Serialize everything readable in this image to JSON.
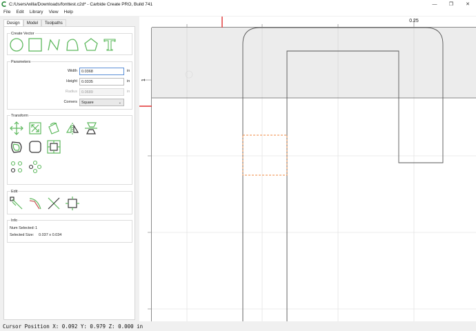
{
  "window": {
    "title": "C:/Users/willa/Downloads/fonttest.c2d* - Carbide Create PRO, Build 741",
    "minimize": "—",
    "restore": "❐",
    "close": "✕"
  },
  "menu": [
    "File",
    "Edit",
    "Library",
    "View",
    "Help"
  ],
  "tabs": [
    "Design",
    "Model",
    "Toolpaths"
  ],
  "create_vector": {
    "title": "Create Vector",
    "tools": [
      "circle-icon",
      "rectangle-icon",
      "polyline-icon",
      "curve-icon",
      "polygon-icon",
      "text-icon"
    ]
  },
  "parameters": {
    "title": "Parameters",
    "width_label": "Width",
    "width_value": "0.0368",
    "height_label": "Height",
    "height_value": "0.0335",
    "radius_label": "Radius",
    "radius_value": "0.0689",
    "unit": "in",
    "corners_label": "Corners",
    "corners_value": "Square"
  },
  "transform": {
    "title": "Transform",
    "tools": [
      "move-icon",
      "scale-icon",
      "rotate-icon",
      "mirror-icon",
      "align-icon",
      "offset-icon",
      "fillet-icon",
      "boolean-icon",
      "array-icon",
      "circle-array-icon"
    ]
  },
  "edit": {
    "title": "Edit",
    "tools": [
      "edit-nodes-icon",
      "smooth-icon",
      "trim-icon",
      "join-icon"
    ]
  },
  "info": {
    "title": "Info",
    "num_selected_label": "Num Selected:",
    "num_selected_value": "1",
    "selected_size_label": "Selected Size:",
    "selected_size_value": "0.037 x 0.034"
  },
  "canvas": {
    "ruler_top_label": "0.25",
    "ruler_left_label": "1"
  },
  "colors": {
    "accent_green": "#5cb85c",
    "selection_orange": "#f08a40",
    "ruler_marker": "#e03030"
  },
  "status": "Cursor Position X: 0.092 Y: 0.979 Z: 0.000 in"
}
